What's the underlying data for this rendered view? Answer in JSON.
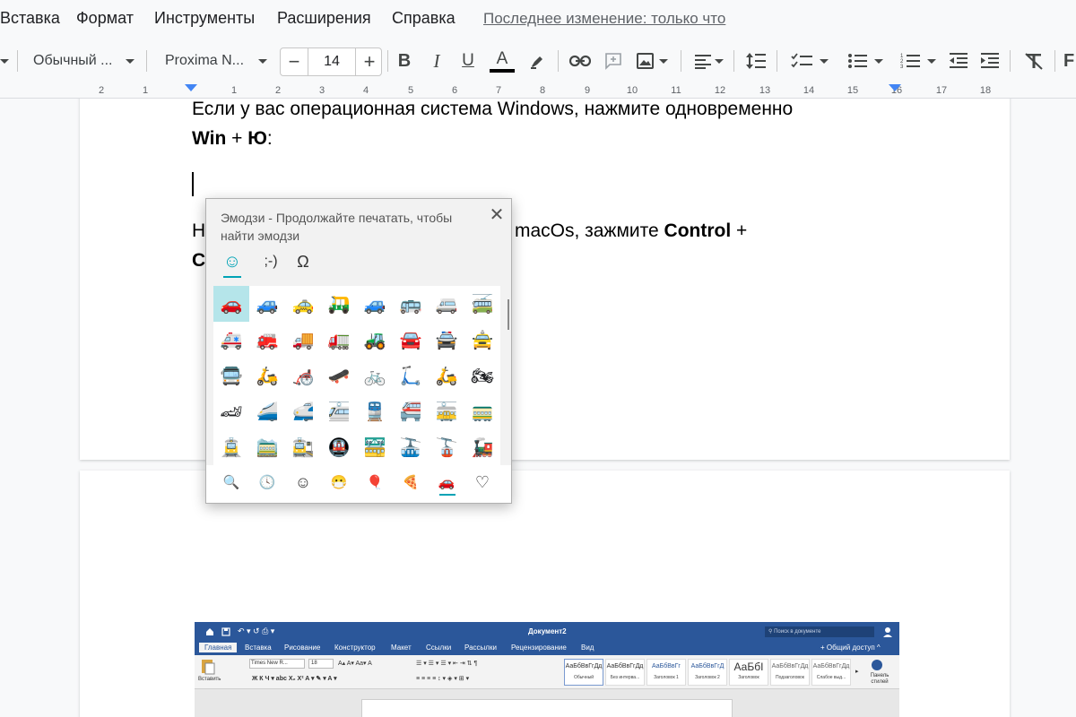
{
  "menu": {
    "items": [
      "Вставка",
      "Формат",
      "Инструменты",
      "Расширения",
      "Справка"
    ],
    "last_edit": "Последнее изменение: только что"
  },
  "toolbar": {
    "style_dropdown": "Обычный ...",
    "font_dropdown": "Proxima N...",
    "font_size": "14",
    "minus_label": "−",
    "plus_label": "+",
    "bold_label": "B",
    "italic_label": "I",
    "underline_label": "U",
    "text_color_label": "A",
    "trailing_label": "F"
  },
  "ruler": {
    "labels": [
      "2",
      "1",
      "1",
      "2",
      "3",
      "4",
      "5",
      "6",
      "7",
      "8",
      "9",
      "10",
      "11",
      "12",
      "13",
      "14",
      "15",
      "16",
      "17",
      "18"
    ]
  },
  "document": {
    "line1": "Если у вас операционная система Windows, нажмите одновременно",
    "line2_bold1": "Win",
    "line2_plus": " + ",
    "line2_bold2": "Ю",
    "line2_colon": ":",
    "line3_prefix": "Н",
    "line3_rest": "ем macOs, зажмите ",
    "line3_bold": "Control",
    "line3_plus": " +",
    "line4_prefix": "C"
  },
  "emoji_panel": {
    "title": "Эмодзи - Продолжайте печатать, чтобы найти эмодзи",
    "close_label": "✕",
    "tabs": [
      {
        "label": "☺",
        "active": true
      },
      {
        "label": ";-)",
        "active": false
      },
      {
        "label": "Ω",
        "active": false
      }
    ],
    "emoji_rows": [
      [
        "🚗",
        "🚙",
        "🚕",
        "🛺",
        "🚙",
        "🚌",
        "🚐",
        "🚎"
      ],
      [
        "🚑",
        "🚒",
        "🚚",
        "🚛",
        "🚜",
        "🚘",
        "🚔",
        "🚖"
      ],
      [
        "🚍",
        "🛵",
        "🦽",
        "🛹",
        "🚲",
        "🛴",
        "🛵",
        "🏍"
      ],
      [
        "🏎",
        "🚄",
        "🚅",
        "🚈",
        "🚆",
        "🚝",
        "🚋",
        "🚃"
      ],
      [
        "🚊",
        "🚞",
        "🚉",
        "🚇",
        "🚟",
        "🚠",
        "🚡",
        "🚂"
      ]
    ],
    "categories": [
      "🔍",
      "🕓",
      "☺",
      "😷",
      "🎈",
      "🍕",
      "🚗",
      "♡"
    ],
    "active_category_index": 6,
    "accent_color": "#00a3b5"
  },
  "word_screenshot": {
    "title": "Документ2",
    "search_placeholder": "Поиск в документе",
    "share_label": "Общий доступ",
    "tabs": [
      "Главная",
      "Вставка",
      "Рисование",
      "Конструктор",
      "Макет",
      "Ссылки",
      "Рассылки",
      "Рецензирование",
      "Вид"
    ],
    "font_name": "Times New R...",
    "font_size": "18",
    "paste_label": "Вставить",
    "styles": [
      {
        "preview": "АаБбВвГгДд",
        "name": "Обычный"
      },
      {
        "preview": "АаБбВвГгДд",
        "name": "Без интерва..."
      },
      {
        "preview": "АаБбВвГг",
        "name": "Заголовок 1"
      },
      {
        "preview": "АаБбВвГгД",
        "name": "Заголовок 2"
      },
      {
        "preview": "АаБбI",
        "name": "Заголовок"
      },
      {
        "preview": "АаБбВвГгДд",
        "name": "Подзаголовок"
      },
      {
        "preview": "АаБбВвГгДд",
        "name": "Слабое выд..."
      }
    ],
    "styles_pane_label": "Панель стилей"
  }
}
